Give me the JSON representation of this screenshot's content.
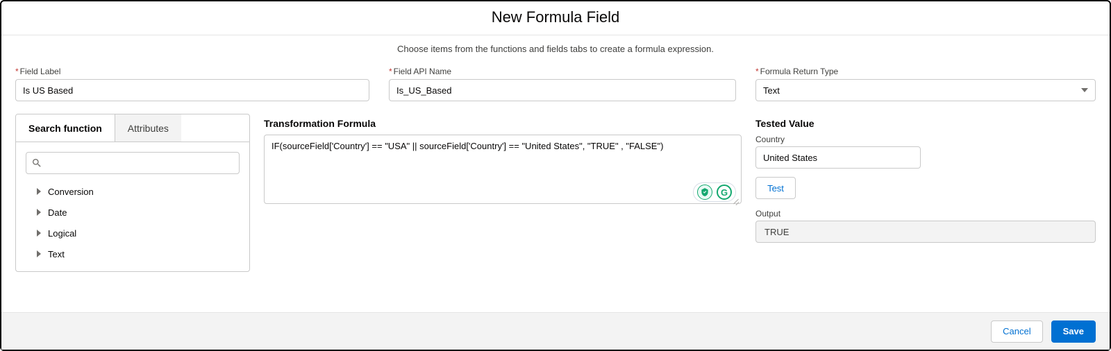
{
  "modal": {
    "title": "New Formula Field",
    "help_text": "Choose items from the functions and fields tabs to create a formula expression."
  },
  "fields": {
    "label": {
      "label": "Field Label",
      "value": "Is US Based"
    },
    "api_name": {
      "label": "Field API Name",
      "value": "Is_US_Based"
    },
    "return_type": {
      "label": "Formula Return Type",
      "value": "Text"
    }
  },
  "left_panel": {
    "tabs": {
      "search_function": "Search function",
      "attributes": "Attributes"
    },
    "search_placeholder": "",
    "categories": [
      "Conversion",
      "Date",
      "Logical",
      "Text"
    ]
  },
  "formula": {
    "title": "Transformation Formula",
    "value": "IF(sourceField['Country'] == \"USA\" || sourceField['Country'] == \"United States\", \"TRUE\" , \"FALSE\")"
  },
  "tested": {
    "title": "Tested Value",
    "field_label": "Country",
    "field_value": "United States",
    "test_button": "Test",
    "output_label": "Output",
    "output_value": "TRUE"
  },
  "footer": {
    "cancel": "Cancel",
    "save": "Save"
  }
}
